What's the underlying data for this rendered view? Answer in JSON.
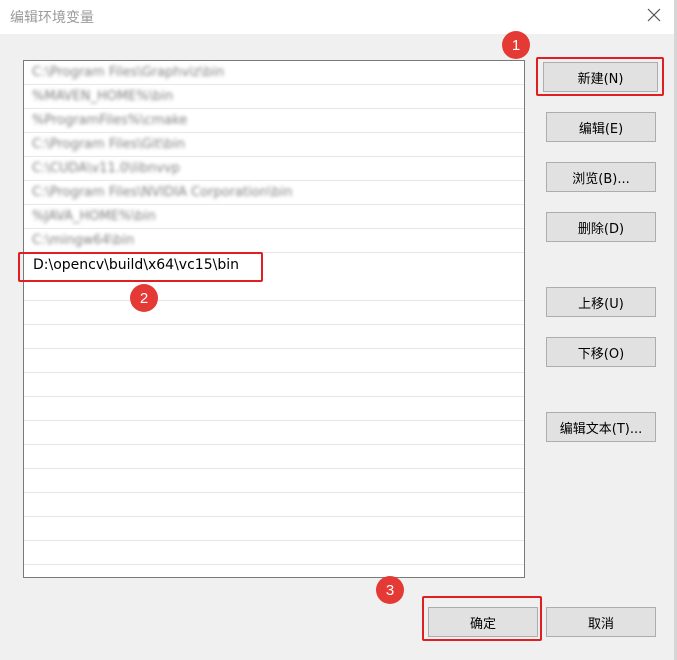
{
  "window": {
    "title": "编辑环境变量"
  },
  "list": {
    "items": [
      "C:\\Program Files\\Graphviz\\bin",
      "%MAVEN_HOME%\\bin",
      "%ProgramFiles%\\cmake",
      "C:\\Program Files\\Git\\bin",
      "C:\\CUDA\\v11.0\\libnvvp",
      "C:\\Program Files\\NVIDIA Corporation\\bin",
      "%JAVA_HOME%\\bin",
      "C:\\mingw64\\bin"
    ],
    "editing_value": "D:\\opencv\\build\\x64\\vc15\\bin"
  },
  "buttons": {
    "new": "新建(N)",
    "edit": "编辑(E)",
    "browse": "浏览(B)...",
    "delete": "删除(D)",
    "move_up": "上移(U)",
    "move_down": "下移(O)",
    "edit_text": "编辑文本(T)...",
    "ok": "确定",
    "cancel": "取消"
  },
  "annotations": {
    "step1": "1",
    "step2": "2",
    "step3": "3"
  },
  "colors": {
    "highlight": "#e02020",
    "badge": "#e53935"
  }
}
